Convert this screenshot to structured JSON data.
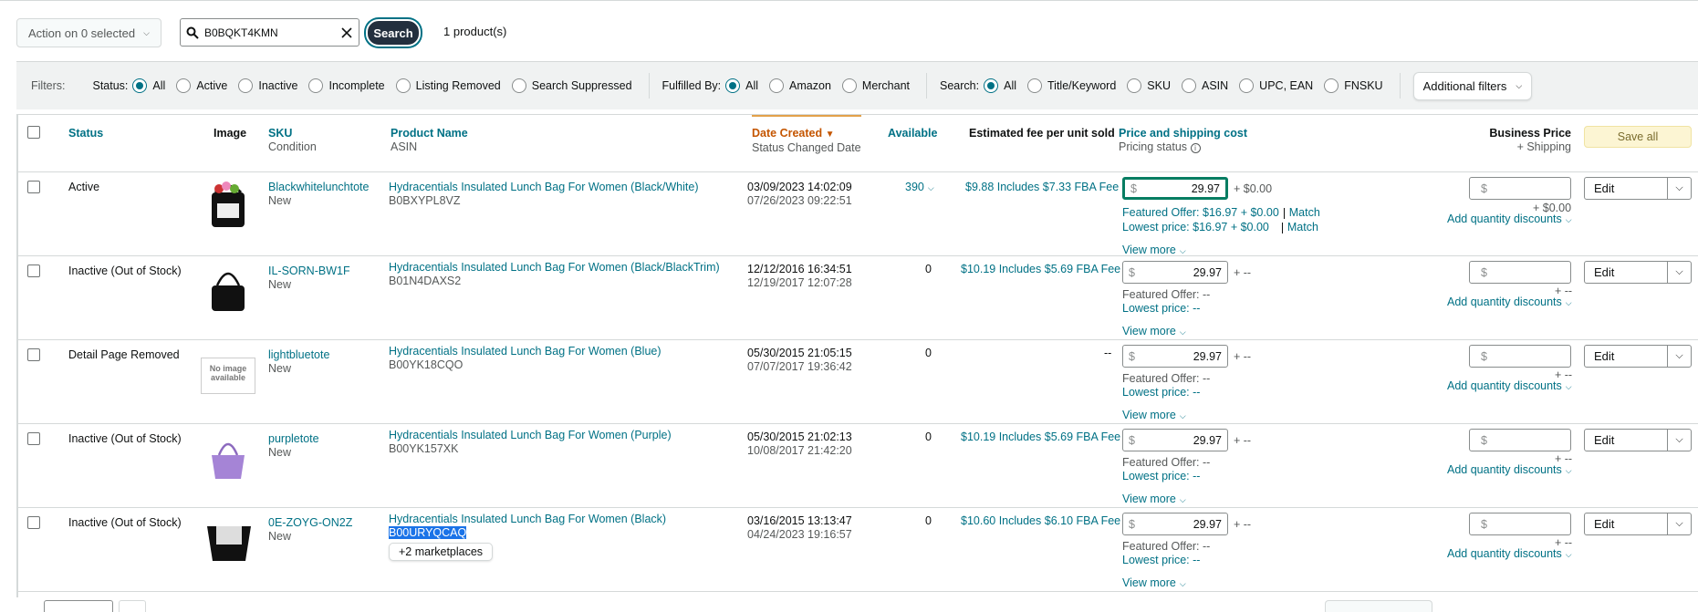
{
  "toolbar": {
    "action_label": "Action on 0 selected",
    "search_value": "B0BQKT4KMN",
    "search_button": "Search",
    "product_count": "1 product(s)"
  },
  "filters": {
    "label": "Filters:",
    "status_label": "Status:",
    "status_options": [
      "All",
      "Active",
      "Inactive",
      "Incomplete",
      "Listing Removed",
      "Search Suppressed"
    ],
    "fulfilled_label": "Fulfilled By:",
    "fulfilled_options": [
      "All",
      "Amazon",
      "Merchant"
    ],
    "search_label": "Search:",
    "search_options": [
      "All",
      "Title/Keyword",
      "SKU",
      "ASIN",
      "UPC, EAN",
      "FNSKU"
    ],
    "additional": "Additional filters"
  },
  "headers": {
    "status": "Status",
    "image": "Image",
    "sku": "SKU",
    "condition": "Condition",
    "product_name": "Product Name",
    "asin": "ASIN",
    "date_created": "Date Created",
    "status_changed": "Status Changed Date",
    "available": "Available",
    "fee": "Estimated fee per unit sold",
    "price": "Price and shipping cost",
    "pricing_status": "Pricing status",
    "business_price": "Business Price",
    "shipping": "+ Shipping",
    "save_all": "Save all"
  },
  "rows": [
    {
      "status": "Active",
      "sku": "Blackwhitelunchtote",
      "condition": "New",
      "name": "Hydracentials Insulated Lunch Bag For Women (Black/White)",
      "asin": "B0BXYPL8VZ",
      "created": "03/09/2023 14:02:09",
      "changed": "07/26/2023 09:22:51",
      "available": "390",
      "fee": "$9.88 Includes $7.33 FBA Fee",
      "price": "29.97",
      "ship": "+ $0.00",
      "featured": "Featured Offer: $16.97 + $0.00",
      "lowest": "Lowest price: $16.97 + $0.00",
      "match": "Match",
      "view_more": "View more",
      "biz_ship": "+ $0.00",
      "qty": "Add quantity discounts",
      "edit": "Edit"
    },
    {
      "status": "Inactive (Out of Stock)",
      "sku": "IL-SORN-BW1F",
      "condition": "New",
      "name": "Hydracentials Insulated Lunch Bag For Women (Black/BlackTrim)",
      "asin": "B01N4DAXS2",
      "created": "12/12/2016 16:34:51",
      "changed": "12/19/2017 12:07:28",
      "available": "0",
      "fee": "$10.19 Includes $5.69 FBA Fee",
      "price": "29.97",
      "ship": "+ --",
      "featured": "Featured Offer: --",
      "lowest": "Lowest price: --",
      "view_more": "View more",
      "biz_ship": "+ --",
      "qty": "Add quantity discounts",
      "edit": "Edit"
    },
    {
      "status": "Detail Page Removed",
      "sku": "lightbluetote",
      "condition": "New",
      "name": "Hydracentials Insulated Lunch Bag For Women (Blue)",
      "asin": "B00YK18CQO",
      "created": "05/30/2015 21:05:15",
      "changed": "07/07/2017 19:36:42",
      "available": "0",
      "fee": "--",
      "price": "29.97",
      "ship": "+ --",
      "featured": "Featured Offer: --",
      "lowest": "Lowest price: --",
      "view_more": "View more",
      "biz_ship": "+ --",
      "qty": "Add quantity discounts",
      "edit": "Edit",
      "no_image": "No image available"
    },
    {
      "status": "Inactive (Out of Stock)",
      "sku": "purpletote",
      "condition": "New",
      "name": "Hydracentials Insulated Lunch Bag For Women (Purple)",
      "asin": "B00YK157XK",
      "created": "05/30/2015 21:02:13",
      "changed": "10/08/2017 21:42:20",
      "available": "0",
      "fee": "$10.19 Includes $5.69 FBA Fee",
      "price": "29.97",
      "ship": "+ --",
      "featured": "Featured Offer: --",
      "lowest": "Lowest price: --",
      "view_more": "View more",
      "biz_ship": "+ --",
      "qty": "Add quantity discounts",
      "edit": "Edit"
    },
    {
      "status": "Inactive (Out of Stock)",
      "sku": "0E-ZOYG-ON2Z",
      "condition": "New",
      "name": "Hydracentials Insulated Lunch Bag For Women (Black)",
      "asin": "B00URYQCAQ",
      "created": "03/16/2015 13:13:47",
      "changed": "04/24/2023 19:16:57",
      "available": "0",
      "fee": "$10.60 Includes $6.10 FBA Fee",
      "price": "29.97",
      "ship": "+ --",
      "featured": "Featured Offer: --",
      "lowest": "Lowest price: --",
      "view_more": "View more",
      "marketplaces": "+2 marketplaces",
      "biz_ship": "+ --",
      "qty": "Add quantity discounts",
      "edit": "Edit"
    }
  ],
  "biz_placeholder": "$",
  "price_symbol": "$",
  "colors": {
    "teal": "#007185",
    "orange": "#c45500",
    "focus_green": "#067d62",
    "dark_button": "#232f3e"
  }
}
